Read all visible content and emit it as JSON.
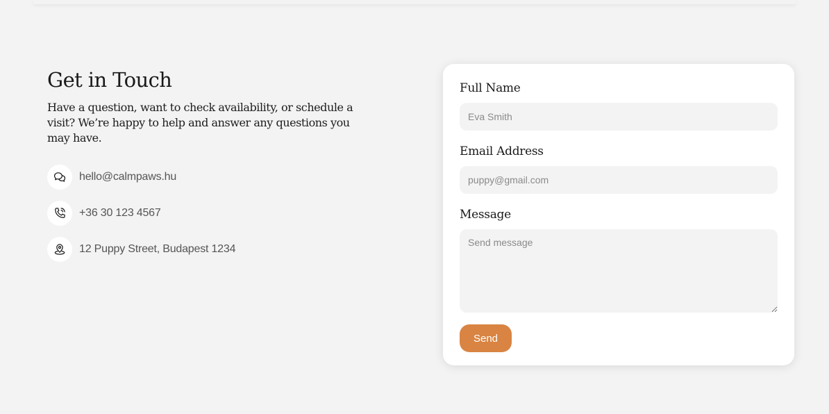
{
  "contact": {
    "title": "Get in Touch",
    "description": "Have a question, want to check availability, or schedule a visit? We’re happy to help and answer any questions you may have.",
    "items": [
      {
        "icon": "chat-bubbles-icon",
        "text": "hello@calmpaws.hu"
      },
      {
        "icon": "phone-icon",
        "text": "+36 30 123 4567"
      },
      {
        "icon": "map-pin-icon",
        "text": "12 Puppy Street, Budapest 1234"
      }
    ]
  },
  "form": {
    "name_label": "Full Name",
    "name_placeholder": "Eva Smith",
    "email_label": "Email Address",
    "email_placeholder": "puppy@gmail.com",
    "message_label": "Message",
    "message_placeholder": "Send message",
    "send_label": "Send"
  },
  "colors": {
    "background": "#f2f3f2",
    "card": "#ffffff",
    "accent": "#d98442"
  }
}
